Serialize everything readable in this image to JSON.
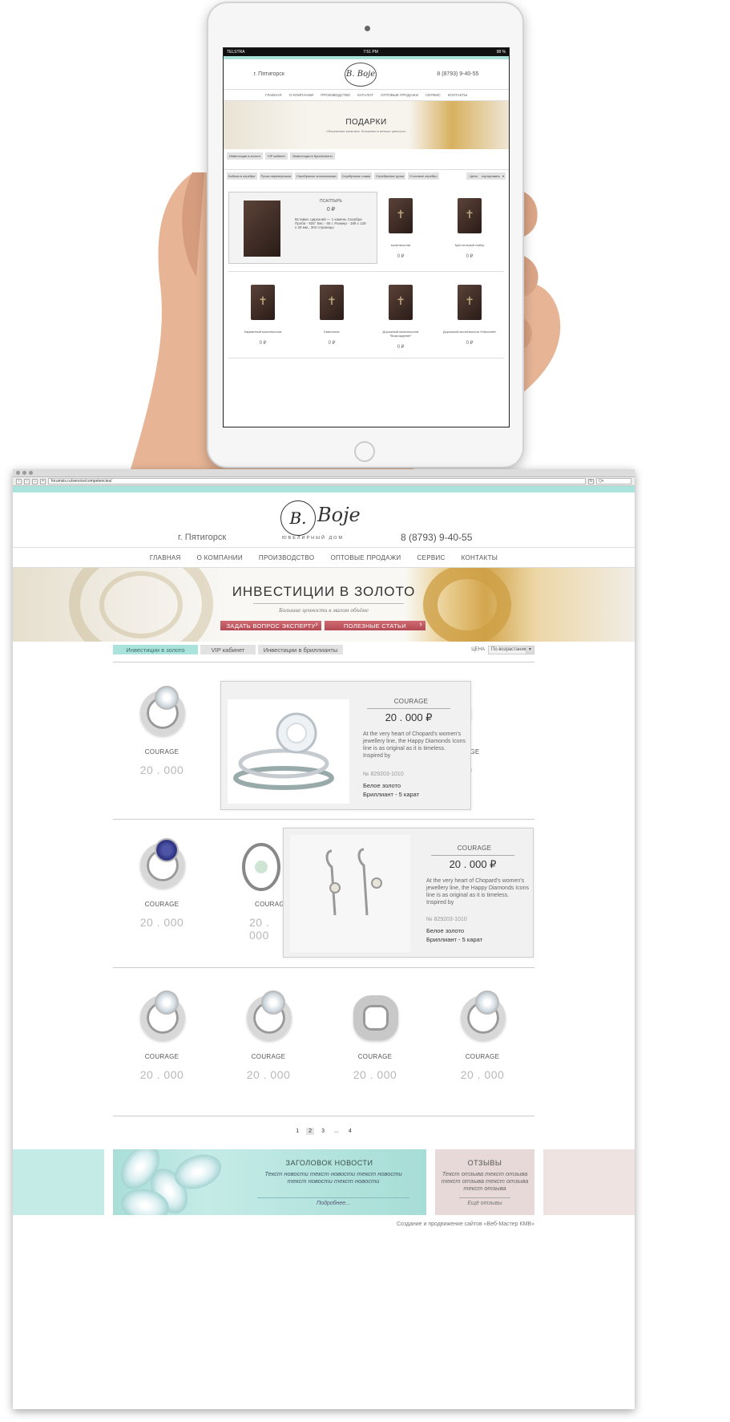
{
  "tablet": {
    "status_carrier": "TELSTRA",
    "status_time": "7:51 PM",
    "status_battery": "98 %",
    "city": "г. Пятигорск",
    "phone": "8 (8793) 9-40-55",
    "logo_text": "B. Boje",
    "nav": [
      "ГЛАВНАЯ",
      "О КОМПАНИИ",
      "ПРОИЗВОДСТВО",
      "КАТАЛОГ",
      "ОПТОВЫЕ ПРОДАЖИ",
      "СЕРВИС",
      "КОНТАКТЫ"
    ],
    "banner_title": "ПОДАРКИ",
    "banner_sub": "Сбережение капитала. Вложения в вечные ценности.",
    "tabs": [
      "Инвестиции в золото",
      "VIP кабинет",
      "Инвестиции в бриллианты"
    ],
    "cats": [
      "Библии в серебре",
      "Ручки-перевертыши",
      "Серебряные колокольчики",
      "Серебряные ложки",
      "Серебряные ручки",
      "Столовое серебро"
    ],
    "sort_label": "Цена",
    "sort_value": "сортировать",
    "popup": {
      "name": "ПСАЛТЫРЬ",
      "price": "0 ₽",
      "desc": "Вставки: цирконий — 1 камень Скорбра Проба - 925° Вес - 65 г. Размер - 188 х 128 х 28 мм., 304 страницы"
    },
    "row1": [
      {
        "name": "молитвослов",
        "price": "0 ₽"
      },
      {
        "name": "Крестильный набор",
        "price": "0 ₽"
      }
    ],
    "row2": [
      {
        "name": "Карманный молитвослов",
        "price": "0 ₽"
      },
      {
        "name": "Евангелие",
        "price": "0 ₽"
      },
      {
        "name": "Дорожный молитвослов \"Возрождение\"",
        "price": "0 ₽"
      },
      {
        "name": "Дорожный молитвослов «Николай»",
        "price": "0 ₽"
      }
    ]
  },
  "browser": {
    "url": "forumsis.ru/service/competencies/",
    "search_icon": "Q▾"
  },
  "site": {
    "city": "г. Пятигорск",
    "phone": "8 (8793) 9-40-55",
    "logo_mark": "B.",
    "logo_script": "Boje",
    "logo_sub": "ЮВЕЛИРНЫЙ ДОМ",
    "nav": [
      "ГЛАВНАЯ",
      "О КОМПАНИИ",
      "ПРОИЗВОДСТВО",
      "ОПТОВЫЕ ПРОДАЖИ",
      "СЕРВИС",
      "КОНТАКТЫ"
    ],
    "banner": {
      "title": "ИНВЕСТИЦИИ В ЗОЛОТО",
      "subtitle": "Большие ценности в малом объёме",
      "cta_left": "ЗАДАТЬ ВОПРОС ЭКСПЕРТУ",
      "cta_right": "ПОЛЕЗНЫЕ СТАТЬИ"
    },
    "filter": {
      "tabs": [
        "Инвестиции в золото",
        "VIP кабинет",
        "Инвестиции в бриллианты"
      ],
      "sort_label": "ЦЕНА",
      "sort_value": "По возрастанию"
    },
    "products": {
      "row1": [
        {
          "name": "COURAGE",
          "price": "20 . 000"
        },
        {
          "name": "COURAGE",
          "price": ". 000"
        }
      ],
      "row2": [
        {
          "name": "COURAGE",
          "price": "20 . 000"
        },
        {
          "name": "COURAG",
          "price": "20 . 000"
        }
      ],
      "row3": [
        {
          "name": "COURAGE",
          "price": "20 . 000"
        },
        {
          "name": "COURAGE",
          "price": "20 . 000"
        },
        {
          "name": "COURAGE",
          "price": "20 . 000"
        },
        {
          "name": "COURAGE",
          "price": "20 . 000"
        }
      ]
    },
    "popup1": {
      "name": "COURAGE",
      "price": "20 . 000 ₽",
      "desc": "At the very heart of Chopard's women's jewellery line, the Happy Diamonds Icons line is as original as it is timeless. Inspired by",
      "sku": "№ 829203-1010",
      "metal": "Белое золото",
      "stone": "Бриллиант - 5 карат"
    },
    "popup2": {
      "name": "COURAGE",
      "price": "20 . 000 ₽",
      "desc": "At the very heart of Chopard's women's jewellery line, the Happy Diamonds Icons line is as original as it is timeless. Inspired by",
      "sku": "№ 829203-1010",
      "metal": "Белое золото",
      "stone": "Бриллиант - 5 карат"
    },
    "pager": [
      "1",
      "2",
      "3",
      "...",
      "4"
    ],
    "news": {
      "title": "ЗАГОЛОВОК НОВОСТИ",
      "text": "Текст новости текст новости текст новости текст новости текст новости",
      "more": "Подробнее..."
    },
    "reviews": {
      "title": "ОТЗЫВЫ",
      "text": "Текст отзыва текст отзыва текст отзыва текст отзыва текст отзыва",
      "more": "Ещё отзывы"
    },
    "footer": "Создание и продвижение сайтов «Веб-Мастер КМВ»"
  },
  "colors": {
    "accent_mint": "#a9e3dc",
    "cta_red": "#c0505a",
    "review_pink": "#e6d9d7"
  }
}
